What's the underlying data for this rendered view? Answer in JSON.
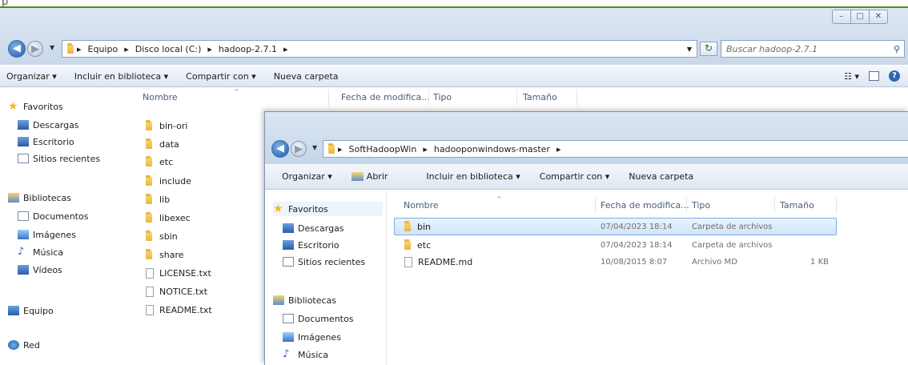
{
  "top_text": "p",
  "window1": {
    "window_buttons": [
      "–",
      "□",
      "✕"
    ],
    "breadcrumb": [
      "Equipo",
      "Disco local (C:)",
      "hadoop-2.7.1"
    ],
    "search_placeholder": "Buscar hadoop-2.7.1",
    "toolbar": {
      "organize": "Organizar ▾",
      "include": "Incluir en biblioteca ▾",
      "share": "Compartir con ▾",
      "new_folder": "Nueva carpeta"
    },
    "columns": {
      "name": "Nombre",
      "date": "Fecha de modifica...",
      "type": "Tipo",
      "size": "Tamaño"
    },
    "nav": {
      "favorites": "Favoritos",
      "downloads": "Descargas",
      "desktop": "Escritorio",
      "recent": "Sitios recientes",
      "libraries": "Bibliotecas",
      "documents": "Documentos",
      "images": "Imágenes",
      "music": "Música",
      "videos": "Vídeos",
      "computer": "Equipo",
      "network": "Red"
    },
    "files": [
      {
        "name": "bin-ori",
        "kind": "folder"
      },
      {
        "name": "data",
        "kind": "folder"
      },
      {
        "name": "etc",
        "kind": "folder"
      },
      {
        "name": "include",
        "kind": "folder"
      },
      {
        "name": "lib",
        "kind": "folder"
      },
      {
        "name": "libexec",
        "kind": "folder"
      },
      {
        "name": "sbin",
        "kind": "folder"
      },
      {
        "name": "share",
        "kind": "folder"
      },
      {
        "name": "LICENSE.txt",
        "kind": "file"
      },
      {
        "name": "NOTICE.txt",
        "kind": "file"
      },
      {
        "name": "README.txt",
        "kind": "file"
      }
    ]
  },
  "window2": {
    "breadcrumb": [
      "SoftHadoopWin",
      "hadooponwindows-master"
    ],
    "toolbar": {
      "organize": "Organizar ▾",
      "open": "Abrir",
      "include": "Incluir en biblioteca ▾",
      "share": "Compartir con ▾",
      "new_folder": "Nueva carpeta"
    },
    "columns": {
      "name": "Nombre",
      "date": "Fecha de modifica...",
      "type": "Tipo",
      "size": "Tamaño"
    },
    "nav": {
      "favorites": "Favoritos",
      "downloads": "Descargas",
      "desktop": "Escritorio",
      "recent": "Sitios recientes",
      "libraries": "Bibliotecas",
      "documents": "Documentos",
      "images": "Imágenes",
      "music": "Música"
    },
    "files": [
      {
        "name": "bin",
        "date": "07/04/2023 18:14",
        "type": "Carpeta de archivos",
        "size": "",
        "kind": "folder",
        "selected": true
      },
      {
        "name": "etc",
        "date": "07/04/2023 18:14",
        "type": "Carpeta de archivos",
        "size": "",
        "kind": "folder"
      },
      {
        "name": "README.md",
        "date": "10/08/2015 8:07",
        "type": "Archivo MD",
        "size": "1 KB",
        "kind": "file"
      }
    ]
  }
}
